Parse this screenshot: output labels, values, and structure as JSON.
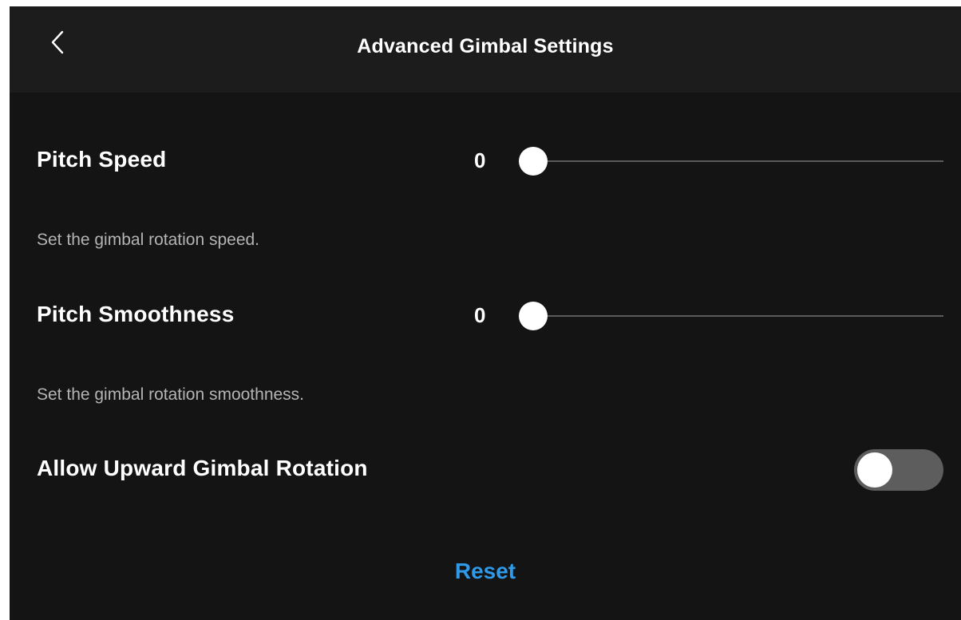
{
  "header": {
    "back_icon": "chevron-left-icon",
    "title": "Advanced Gimbal Settings"
  },
  "pitch_speed": {
    "label": "Pitch Speed",
    "value": "0",
    "level": 0,
    "description": "Set the gimbal rotation speed."
  },
  "pitch_smoothness": {
    "label": "Pitch Smoothness",
    "value": "0",
    "level": 0,
    "description": "Set the gimbal rotation smoothness."
  },
  "upward_rotation": {
    "label": "Allow Upward Gimbal Rotation",
    "enabled": false
  },
  "footer": {
    "reset_label": "Reset"
  },
  "colors": {
    "background": "#141414",
    "header_background": "#1c1c1c",
    "accent": "#2e9ae8",
    "toggle_off": "#5d5d5d",
    "description_text": "#b4b4b4"
  }
}
